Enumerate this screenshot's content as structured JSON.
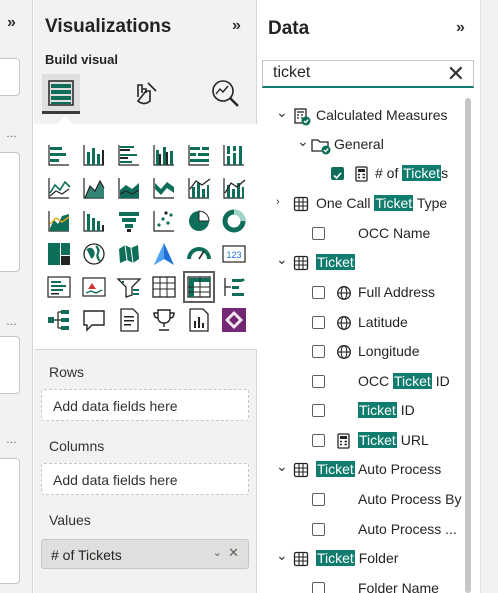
{
  "visualizations": {
    "title": "Visualizations",
    "build_label": "Build visual",
    "tools": [
      "build-visual-icon",
      "format-visual-icon",
      "analytics-icon"
    ],
    "gallery_rows": [
      [
        "stacked-bar-icon",
        "stacked-column-icon",
        "clustered-bar-icon",
        "clustered-column-icon",
        "100-stacked-bar-icon",
        "100-stacked-column-icon"
      ],
      [
        "line-chart-icon",
        "area-chart-icon",
        "stacked-area-icon",
        "ribbon-chart-icon",
        "line-clustered-column-icon",
        "line-stacked-column-icon"
      ],
      [
        "waterfall-icon",
        "funnel-icon",
        "funnel-alt-icon",
        "scatter-icon",
        "pie-chart-icon",
        "donut-chart-icon"
      ],
      [
        "treemap-icon",
        "map-icon",
        "filled-map-icon",
        "azure-map-icon",
        "gauge-icon",
        "card-icon"
      ],
      [
        "multi-row-card-icon",
        "kpi-icon",
        "slicer-icon",
        "table-icon",
        "matrix-icon",
        "key-influencers-icon"
      ],
      [
        "decomposition-tree-icon",
        "qa-icon",
        "smart-narrative-icon",
        "metrics-icon",
        "paginated-report-icon",
        "power-apps-icon"
      ]
    ],
    "wells": {
      "rows_label": "Rows",
      "rows_placeholder": "Add data fields here",
      "columns_label": "Columns",
      "columns_placeholder": "Add data fields here",
      "values_label": "Values",
      "values_field": "# of Tickets"
    }
  },
  "data": {
    "title": "Data",
    "search_value": "ticket",
    "tree": [
      {
        "name": "calculated-measures-table",
        "level": 0,
        "arrow": "down",
        "icon": "calculator-table-icon",
        "parts": [
          "Calculated Measures",
          ""
        ],
        "checkbox": "none"
      },
      {
        "name": "folder-general",
        "level": 1,
        "arrow": "down",
        "icon": "folder-icon",
        "parts": [
          "General",
          ""
        ],
        "checkbox": "none"
      },
      {
        "name": "field-num-of-tickets",
        "level": 2,
        "arrow": "",
        "icon": "measure-icon",
        "parts": [
          "# of ",
          "Ticket",
          "s"
        ],
        "checkbox": "checked"
      },
      {
        "name": "table-one-call-ticket-type",
        "level": 0,
        "arrow": "right",
        "icon": "table-icon",
        "parts": [
          "One Call ",
          "Ticket",
          " Type"
        ],
        "checkbox": "none"
      },
      {
        "name": "field-occ-name",
        "level": 2,
        "arrow": "",
        "icon": "",
        "parts": [
          "OCC Name"
        ],
        "checkbox": "empty"
      },
      {
        "name": "table-ticket",
        "level": 0,
        "arrow": "down",
        "icon": "table-icon",
        "parts": [
          "",
          "Ticket",
          ""
        ],
        "checkbox": "none"
      },
      {
        "name": "field-full-address",
        "level": 2,
        "arrow": "",
        "icon": "globe-icon",
        "parts": [
          "Full Address"
        ],
        "checkbox": "empty"
      },
      {
        "name": "field-latitude",
        "level": 2,
        "arrow": "",
        "icon": "globe-icon",
        "parts": [
          "Latitude"
        ],
        "checkbox": "empty"
      },
      {
        "name": "field-longitude",
        "level": 2,
        "arrow": "",
        "icon": "globe-icon",
        "parts": [
          "Longitude"
        ],
        "checkbox": "empty"
      },
      {
        "name": "field-occ-ticket-id",
        "level": 2,
        "arrow": "",
        "icon": "",
        "parts": [
          "OCC ",
          "Ticket",
          " ID"
        ],
        "checkbox": "empty"
      },
      {
        "name": "field-ticket-id",
        "level": 2,
        "arrow": "",
        "icon": "",
        "parts": [
          "",
          "Ticket",
          " ID"
        ],
        "checkbox": "empty"
      },
      {
        "name": "field-ticket-url",
        "level": 2,
        "arrow": "",
        "icon": "calculator-icon",
        "parts": [
          "",
          "Ticket",
          " URL"
        ],
        "checkbox": "empty"
      },
      {
        "name": "table-ticket-auto-process",
        "level": 0,
        "arrow": "down",
        "icon": "table-icon",
        "parts": [
          "",
          "Ticket",
          " Auto Process"
        ],
        "checkbox": "none"
      },
      {
        "name": "field-auto-process-by",
        "level": 2,
        "arrow": "",
        "icon": "",
        "parts": [
          "Auto Process By"
        ],
        "checkbox": "empty"
      },
      {
        "name": "field-auto-process-ellipsis",
        "level": 2,
        "arrow": "",
        "icon": "",
        "parts": [
          "Auto Process ..."
        ],
        "checkbox": "empty"
      },
      {
        "name": "table-ticket-folder",
        "level": 0,
        "arrow": "down",
        "icon": "table-icon",
        "parts": [
          "",
          "Ticket",
          " Folder"
        ],
        "checkbox": "none"
      },
      {
        "name": "field-folder-name",
        "level": 2,
        "arrow": "",
        "icon": "",
        "parts": [
          "Folder Name"
        ],
        "checkbox": "empty"
      }
    ]
  },
  "colors": {
    "accent": "#107c6e",
    "highlight": "#107c6e",
    "power_apps": "#742774"
  }
}
